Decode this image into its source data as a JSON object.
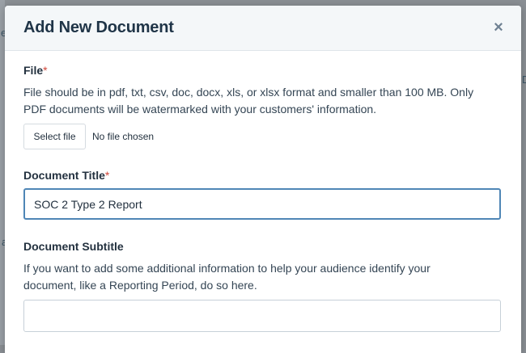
{
  "modal": {
    "title": "Add New Document",
    "close_glyph": "×"
  },
  "file_field": {
    "label": "File",
    "required_mark": "*",
    "help": "File should be in pdf, txt, csv, doc, docx, xls, or xlsx format and smaller than 100 MB. Only PDF documents will be watermarked with your customers' information.",
    "button_label": "Select file",
    "status": "No file chosen"
  },
  "title_field": {
    "label": "Document Title",
    "required_mark": "*",
    "value": "SOC 2 Type 2 Report"
  },
  "subtitle_field": {
    "label": "Document Subtitle",
    "help": "If you want to add some additional information to help your audience identify your document, like a Reporting Period, do so here.",
    "value": ""
  },
  "backdrop": {
    "left_fragment": "e",
    "left_fragment_2": "a",
    "right_fragment": "D"
  },
  "colors": {
    "required": "#d0473a",
    "focus_border": "#4f86b6",
    "header_bg": "#f4f7f9"
  }
}
